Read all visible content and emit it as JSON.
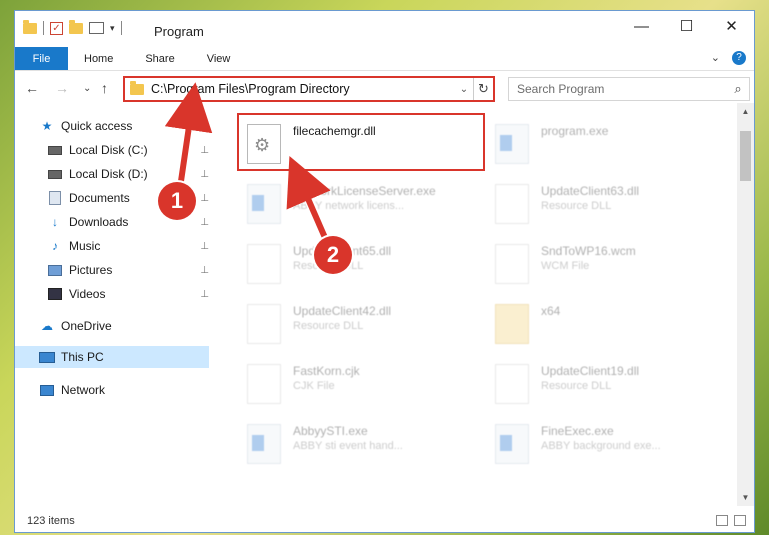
{
  "window": {
    "title": "Program",
    "controls": {
      "minimize": "—",
      "maximize": "☐",
      "close": "✕"
    }
  },
  "ribbon": {
    "tabs": [
      {
        "label": "File"
      },
      {
        "label": "Home"
      },
      {
        "label": "Share"
      },
      {
        "label": "View"
      }
    ],
    "expand": "⌄",
    "help": "?"
  },
  "nav": {
    "back": "←",
    "forward": "→",
    "recent": "⌄",
    "up": "↑"
  },
  "address": {
    "path": "C:\\Program Files\\Program Directory",
    "dropdown": "⌄",
    "refresh": "↻"
  },
  "search": {
    "placeholder": "Search Program",
    "icon": "⌕"
  },
  "sidebar": {
    "items": [
      {
        "label": "Quick access",
        "icon": "star-icon"
      },
      {
        "label": "Local Disk (C:)",
        "icon": "disk-icon",
        "pinned": true
      },
      {
        "label": "Local Disk (D:)",
        "icon": "disk-icon",
        "pinned": true
      },
      {
        "label": "Documents",
        "icon": "documents-icon",
        "pinned": true
      },
      {
        "label": "Downloads",
        "icon": "download-icon",
        "pinned": true
      },
      {
        "label": "Music",
        "icon": "music-icon",
        "pinned": true
      },
      {
        "label": "Pictures",
        "icon": "pictures-icon",
        "pinned": true
      },
      {
        "label": "Videos",
        "icon": "videos-icon",
        "pinned": true
      },
      {
        "label": "OneDrive",
        "icon": "cloud-icon"
      },
      {
        "label": "This PC",
        "icon": "computer-icon",
        "selected": true
      },
      {
        "label": "Network",
        "icon": "network-icon"
      }
    ],
    "pin_glyph": "📌"
  },
  "files": [
    {
      "name": "filecachemgr.dll",
      "type": "",
      "icon": "dll"
    },
    {
      "name": "program.exe",
      "type": "",
      "icon": "exe"
    },
    {
      "name": "NetworkLicenseServer.exe",
      "type": "ABBY network licens...",
      "icon": "exe"
    },
    {
      "name": "UpdateClient63.dll",
      "type": "Resource DLL",
      "icon": "blank"
    },
    {
      "name": "UpdateClient65.dll",
      "type": "Resource DLL",
      "icon": "blank"
    },
    {
      "name": "SndToWP16.wcm",
      "type": "WCM File",
      "icon": "blank"
    },
    {
      "name": "UpdateClient42.dll",
      "type": "Resource DLL",
      "icon": "blank"
    },
    {
      "name": "x64",
      "type": "",
      "icon": "folder"
    },
    {
      "name": "FastKorn.cjk",
      "type": "CJK File",
      "icon": "blank"
    },
    {
      "name": "UpdateClient19.dll",
      "type": "Resource DLL",
      "icon": "blank"
    },
    {
      "name": "AbbyySTI.exe",
      "type": "ABBY sti event hand...",
      "icon": "exe"
    },
    {
      "name": "FineExec.exe",
      "type": "ABBY background exe...",
      "icon": "exe"
    }
  ],
  "status": {
    "count": "123 items"
  },
  "callouts": {
    "one": "1",
    "two": "2"
  },
  "colors": {
    "accent": "#1979ca",
    "highlight": "#d9352b",
    "selection": "#cce8ff"
  }
}
